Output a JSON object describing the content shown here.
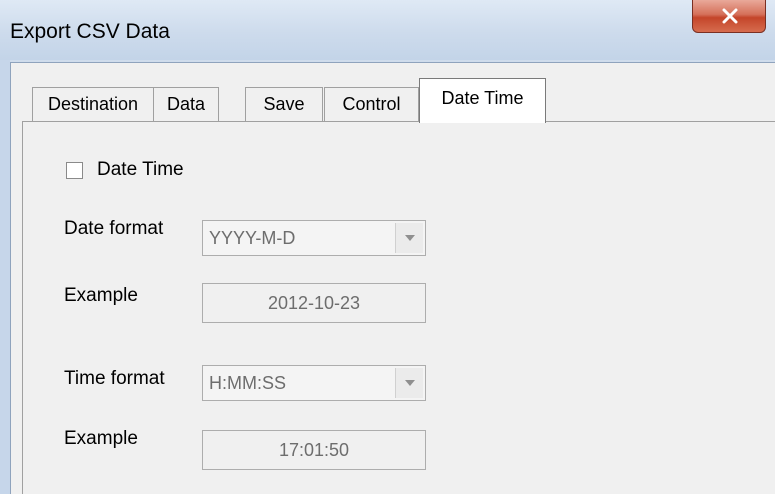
{
  "window": {
    "title": "Export CSV Data"
  },
  "tabs": [
    {
      "label": "Destination",
      "active": false
    },
    {
      "label": "Data",
      "active": false
    },
    {
      "label": "Save",
      "active": false
    },
    {
      "label": "Control",
      "active": false
    },
    {
      "label": "Date Time",
      "active": true
    }
  ],
  "date_time": {
    "checkbox_label": "Date Time",
    "checked": false,
    "date_format_label": "Date format",
    "date_format_value": "YYYY-M-D",
    "date_example_label": "Example",
    "date_example_value": "2012-10-23",
    "time_format_label": "Time format",
    "time_format_value": "H:MM:SS",
    "time_example_label": "Example",
    "time_example_value": "17:01:50"
  },
  "icons": {
    "close": "close-icon",
    "dropdown": "chevron-down-icon"
  },
  "colors": {
    "close_button": "#c4452a",
    "titlebar": "#cddbec",
    "disabled_text": "#6d6d6d"
  }
}
